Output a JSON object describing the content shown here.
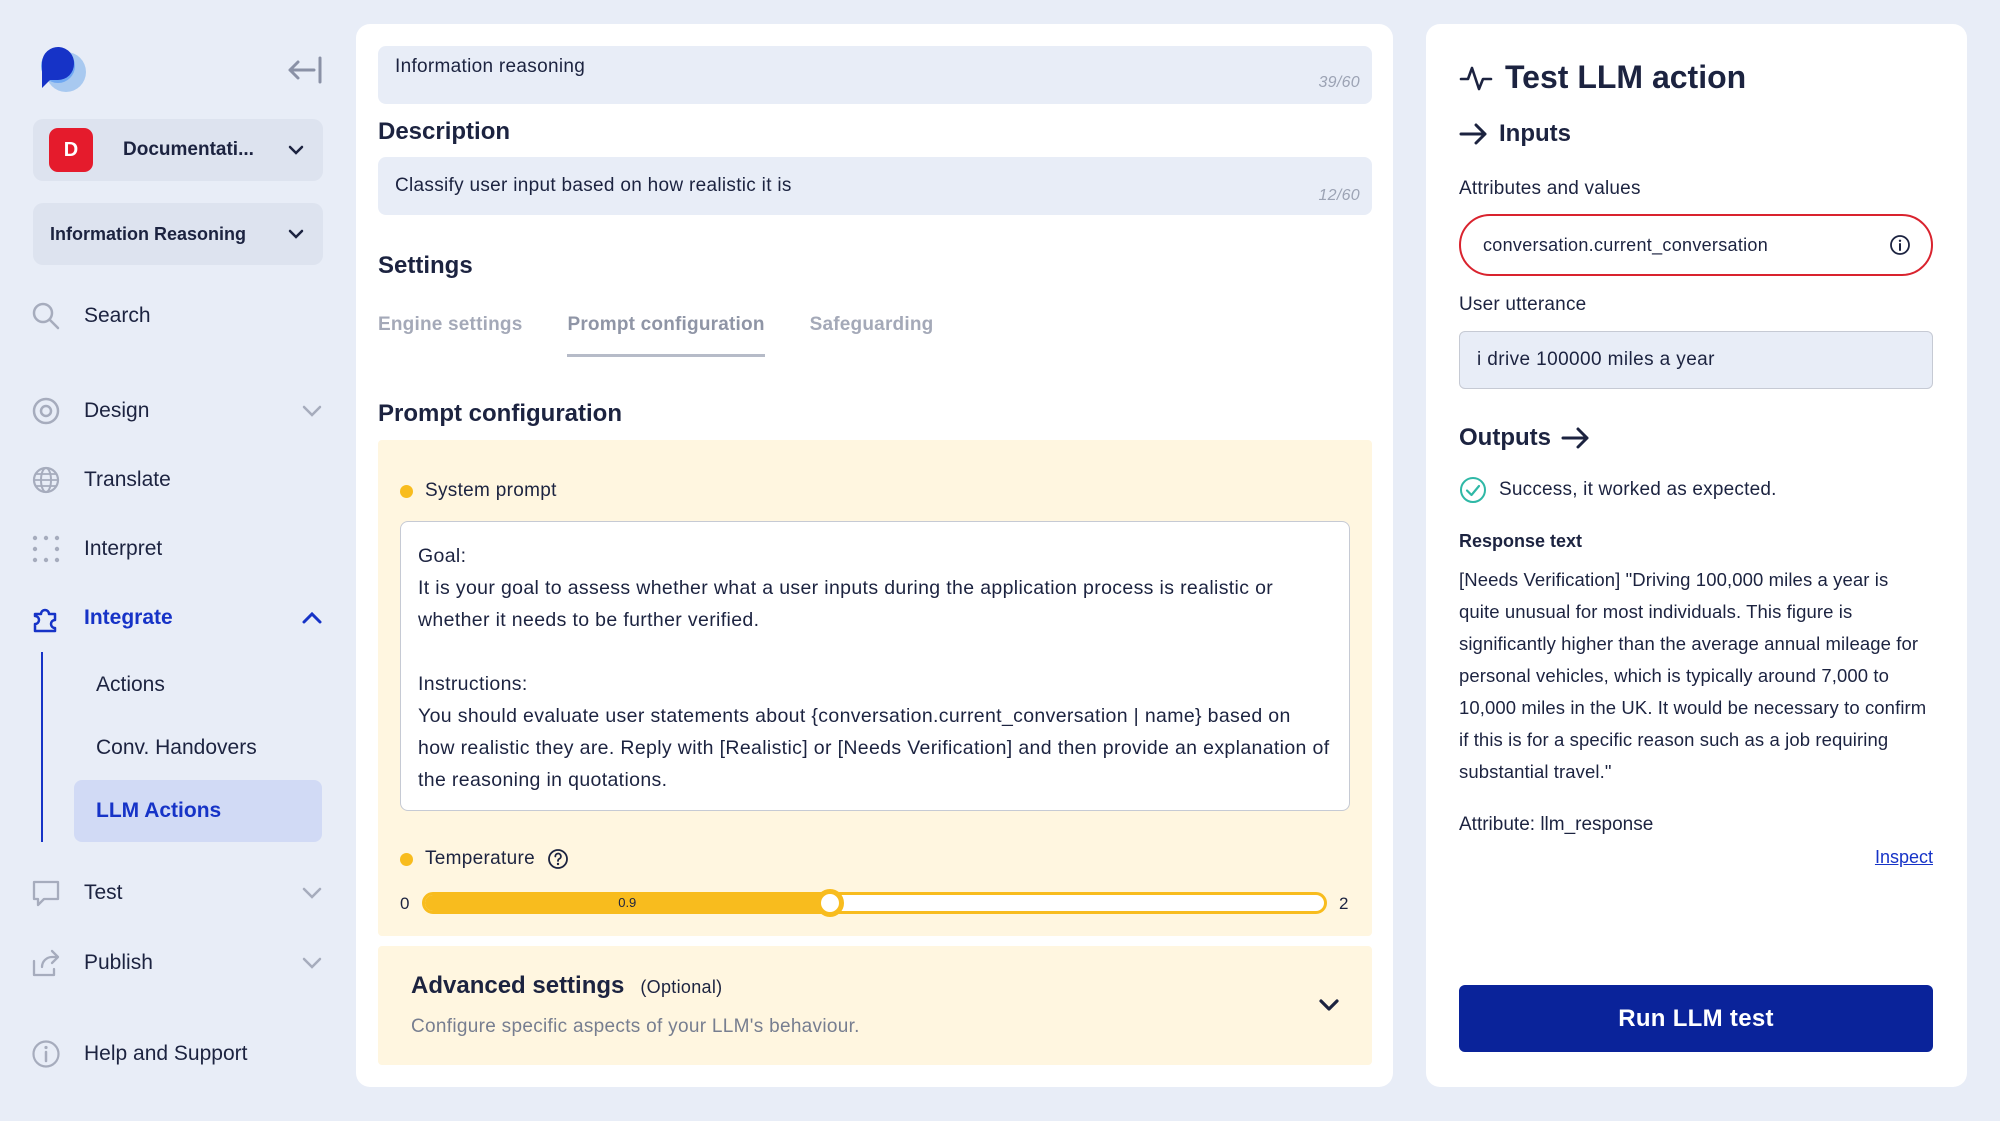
{
  "sidebar": {
    "workspace": {
      "badge": "D",
      "label": "Documentati...",
      "badge_color": "#e51b2c"
    },
    "project": {
      "label": "Information Reasoning"
    },
    "nav": {
      "search": "Search",
      "design": "Design",
      "translate": "Translate",
      "interpret": "Interpret",
      "integrate": "Integrate",
      "test": "Test",
      "publish": "Publish",
      "help": "Help and Support"
    },
    "sub_items": [
      "Actions",
      "Conv. Handovers",
      "LLM Actions"
    ]
  },
  "main": {
    "name_field": {
      "value": "Information reasoning",
      "count": "39/60"
    },
    "description": {
      "heading": "Description",
      "value": "Classify user input based on how realistic it is",
      "count": "12/60"
    },
    "settings_heading": "Settings",
    "tabs": [
      "Engine settings",
      "Prompt configuration",
      "Safeguarding"
    ],
    "prompt_heading": "Prompt configuration",
    "system_prompt_label": "System prompt",
    "system_prompt_text": "Goal:\nIt is your goal to assess whether what a user inputs during the application process is realistic or whether it needs to be further verified.\n\nInstructions:\nYou should evaluate user statements about {conversation.current_conversation | name} based on how realistic they are. Reply with [Realistic] or [Needs Verification] and then provide an explanation of the reasoning in quotations.",
    "temperature": {
      "label": "Temperature",
      "min": "0",
      "max": "2",
      "value": "0.9",
      "value_num": 0.9,
      "min_num": 0,
      "max_num": 2
    },
    "advanced": {
      "title": "Advanced settings",
      "optional": "(Optional)",
      "desc": "Configure specific aspects of your LLM's behaviour."
    }
  },
  "test_panel": {
    "title": "Test LLM action",
    "inputs_heading": "Inputs",
    "attr_label": "Attributes and values",
    "attr_value": "conversation.current_conversation",
    "utterance_label": "User utterance",
    "utterance_value": "i drive 100000 miles a year",
    "outputs_heading": "Outputs",
    "success_text": "Success, it worked as expected.",
    "response_heading": "Response text",
    "response_text": "[Needs Verification] \"Driving 100,000 miles a year is quite unusual for most individuals. This figure is significantly higher than the average annual mileage for personal vehicles, which is typically around 7,000 to 10,000 miles in the UK. It would be necessary to confirm if this is for a specific reason such as a job requiring substantial travel.\"",
    "attribute_line": "Attribute: llm_response",
    "inspect_link": "Inspect",
    "run_button": "Run LLM test"
  },
  "colors": {
    "accent": "#1633c7",
    "primary_button": "#0a239a",
    "warning_fill": "#f8bc1e",
    "error_border": "#d9232e",
    "success": "#2fb8a6"
  }
}
